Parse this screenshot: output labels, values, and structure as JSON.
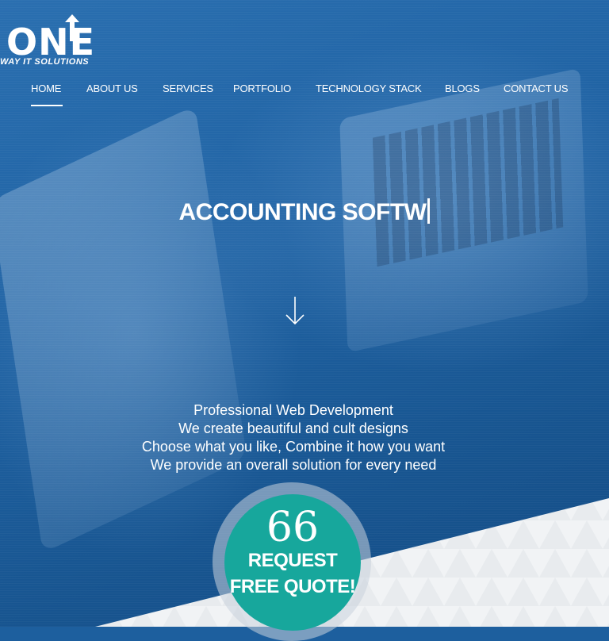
{
  "logo": {
    "wordmark": "ONE",
    "tagline": "WAY IT SOLUTIONS"
  },
  "nav": {
    "items": [
      {
        "label": "HOME",
        "active": true
      },
      {
        "label": "ABOUT US"
      },
      {
        "label": "SERVICES"
      },
      {
        "label": "PORTFOLIO"
      },
      {
        "label": "TECHNOLOGY STACK"
      },
      {
        "label": "BLOGS"
      },
      {
        "label": "CONTACT US"
      }
    ]
  },
  "hero": {
    "headline": "ACCOUNTING SOFTW",
    "taglines": [
      "Professional Web Development",
      "We create beautiful and cult designs",
      "Choose what you like, Combine it how you want",
      "We provide an overall solution for every need"
    ],
    "scroll_icon": "arrow-down-icon"
  },
  "cta": {
    "quote_icon": "quote-icon",
    "mark": "66",
    "line1": "REQUEST",
    "line2": "FREE QUOTE!",
    "color": "#17a79c"
  },
  "colors": {
    "hero_blue": "#1f62a3",
    "accent_teal": "#17a79c",
    "bottom_panel": "#f0f2f4"
  }
}
